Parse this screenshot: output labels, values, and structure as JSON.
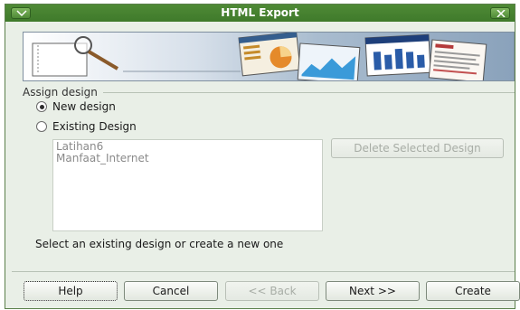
{
  "window": {
    "title": "HTML Export"
  },
  "section": {
    "title": "Assign design"
  },
  "options": {
    "new_design": "New design",
    "existing_design": "Existing Design"
  },
  "designs": [
    "Latihan6",
    "Manfaat_Internet"
  ],
  "delete_button": "Delete Selected Design",
  "hint": "Select an existing design or create a new one",
  "buttons": {
    "help": "Help",
    "cancel": "Cancel",
    "back": "<< Back",
    "next": "Next >>",
    "create": "Create"
  },
  "colors": {
    "titlebar": "#3f7a2b",
    "window_bg": "#e9efe7"
  },
  "icons": {
    "menu": "window-menu-icon",
    "close": "window-close-icon"
  }
}
